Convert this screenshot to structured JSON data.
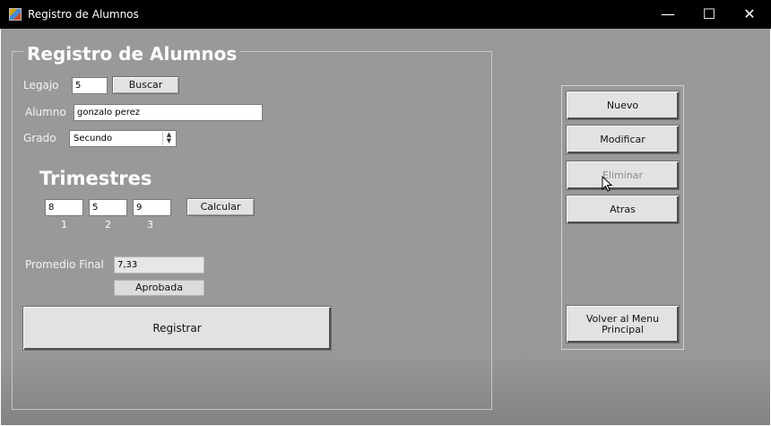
{
  "window": {
    "title": "Registro de Alumnos",
    "minimize_glyph": "—",
    "maximize_glyph": "☐",
    "close_glyph": "✕"
  },
  "form": {
    "group_title": "Registro de Alumnos",
    "legajo": {
      "label": "Legajo",
      "value": "5"
    },
    "buscar_button": "Buscar",
    "alumno": {
      "label": "Alumno",
      "value": "gonzalo perez"
    },
    "grado": {
      "label": "Grado",
      "value": "Secundo"
    },
    "trimestres": {
      "title": "Trimestres",
      "values": [
        "8",
        "5",
        "9"
      ],
      "numbers": [
        "1",
        "2",
        "3"
      ]
    },
    "calcular_button": "Calcular",
    "promedio": {
      "label": "Promedio Final",
      "value": "7,33"
    },
    "estado": "Aprobada",
    "registrar_button": "Registrar"
  },
  "side_panel": {
    "nuevo": "Nuevo",
    "modificar": "Modificar",
    "eliminar": "Eliminar",
    "atras": "Atras",
    "volver": "Volver al Menu Principal"
  },
  "colors": {
    "client_background": "#999999",
    "titlebar": "#000000",
    "button_face": "#e2e2e2"
  }
}
